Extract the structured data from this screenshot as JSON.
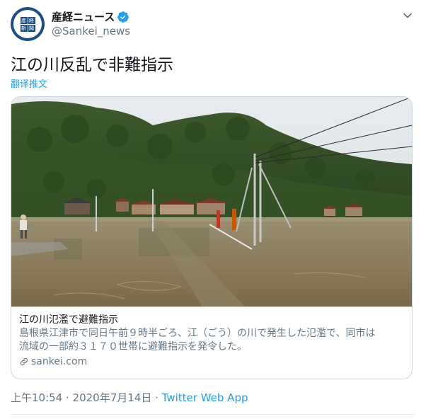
{
  "tweet": {
    "author": {
      "display_name": "産経ニュース",
      "handle": "@Sankei_news",
      "verified": true,
      "avatar": {
        "kanji": [
          "産",
          "経",
          "新",
          "聞"
        ],
        "wordmark": [
          "THE",
          "SANKEI",
          "NEWS"
        ],
        "brand_color": "#1b4e86"
      }
    },
    "more_icon": "chevron-down-icon",
    "text": "江の川反乱で非難指示",
    "translate_label": "翻译推文",
    "card": {
      "image_alt_icon": "photo-flooded-village",
      "title": "江の川氾濫で避難指示",
      "description_line1": "島根県江津市で同日午前９時半ごろ、江（ごう）の川で発生した氾濫で、同市は",
      "description_line2": "流域の一部約３１７０世帯に避難指示を発令した。",
      "domain": "sankei.com"
    },
    "time": "上午10:54",
    "separator": " · ",
    "date": "2020年7月14日",
    "source": "Twitter Web App"
  },
  "colors": {
    "link": "#1da1f2",
    "text": "#14171a",
    "muted": "#657786",
    "border": "#ccd6dd"
  }
}
